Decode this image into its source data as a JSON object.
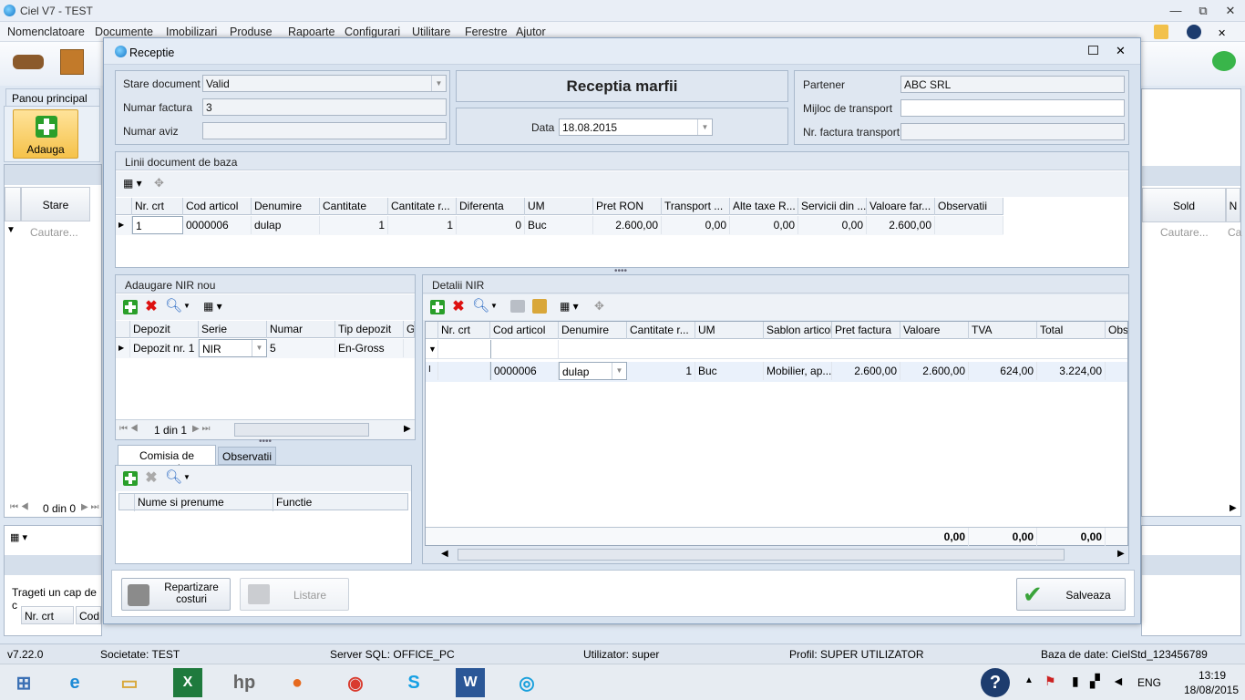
{
  "app": {
    "title": "Ciel V7 - TEST",
    "min": "—",
    "restore": "⧉",
    "close": "✕"
  },
  "menu": [
    "Nomenclatoare",
    "Documente",
    "Imobilizari",
    "Produse",
    "Rapoarte",
    "Configurari",
    "Utilitare",
    "Ferestre",
    "Ajutor"
  ],
  "left": {
    "panou": "Panou principal",
    "adauga": "Adauga",
    "col_stare": "Stare",
    "cautare": "Cautare...",
    "pager": "0 din 0",
    "drag_text": "Trageti un cap de c",
    "col_nr": "Nr. crt",
    "col_cod": "Cod"
  },
  "right": {
    "col_sold": "Sold",
    "cautare": "Cautare...",
    "ca": "Ca"
  },
  "dialog": {
    "title": "Receptie",
    "heading": "Receptia marfii",
    "stare_label": "Stare document",
    "stare_value": "Valid",
    "numar_factura_label": "Numar factura",
    "numar_factura_value": "3",
    "numar_aviz_label": "Numar aviz",
    "numar_aviz_value": "",
    "data_label": "Data",
    "data_value": "18.08.2015",
    "partener_label": "Partener",
    "partener_value": "ABC SRL",
    "transport_label": "Mijloc de transport",
    "transport_value": "",
    "nr_factura_transport_label": "Nr. factura transport",
    "nr_factura_transport_value": "",
    "linii": {
      "title": "Linii document de baza",
      "columns": [
        "Nr. crt",
        "Cod articol",
        "Denumire",
        "Cantitate",
        "Cantitate r...",
        "Diferenta",
        "UM",
        "Pret RON",
        "Transport ...",
        "Alte taxe R...",
        "Servicii din ...",
        "Valoare far...",
        "Observatii"
      ],
      "rows": [
        [
          "1",
          "0000006",
          "dulap",
          "1",
          "1",
          "0",
          "Buc",
          "2.600,00",
          "0,00",
          "0,00",
          "0,00",
          "2.600,00",
          ""
        ]
      ]
    },
    "nir": {
      "title": "Adaugare NIR nou",
      "columns": [
        "Depozit",
        "Serie",
        "Numar",
        "Tip depozit",
        "G"
      ],
      "rows": [
        [
          "Depozit nr. 1",
          "NIR",
          "5",
          "En-Gross"
        ]
      ],
      "pager": "1 din 1"
    },
    "tabs": {
      "comisia": "Comisia de receptie",
      "observatii": "Observatii"
    },
    "comisia": {
      "columns": [
        "Nume si prenume",
        "Functie"
      ]
    },
    "detalii": {
      "title": "Detalii NIR",
      "columns": [
        "Nr. crt",
        "Cod articol",
        "Denumire",
        "Cantitate r...",
        "UM",
        "Sablon articol",
        "Pret factura",
        "Valoare",
        "TVA",
        "Total",
        "Obse"
      ],
      "rows": [
        [
          "",
          "0000006",
          "dulap",
          "1",
          "Buc",
          "Mobilier, ap...",
          "2.600,00",
          "2.600,00",
          "624,00",
          "3.224,00"
        ]
      ],
      "totals": [
        "0,00",
        "0,00",
        "0,00"
      ]
    },
    "buttons": {
      "repartizare": "Repartizare costuri",
      "listare": "Listare",
      "salveaza": "Salveaza"
    }
  },
  "status": {
    "version": "v7.22.0",
    "societate": "Societate: TEST",
    "server": "Server SQL: OFFICE_PC",
    "utilizator": "Utilizator: super",
    "profil": "Profil: SUPER UTILIZATOR",
    "baza": "Baza de date: CielStd_123456789"
  },
  "taskbar": {
    "lang": "ENG",
    "time": "13:19",
    "date": "18/08/2015"
  },
  "colors": {
    "accent": "#2a9f2a",
    "danger": "#d11111",
    "title_blue": "#1276c8"
  }
}
